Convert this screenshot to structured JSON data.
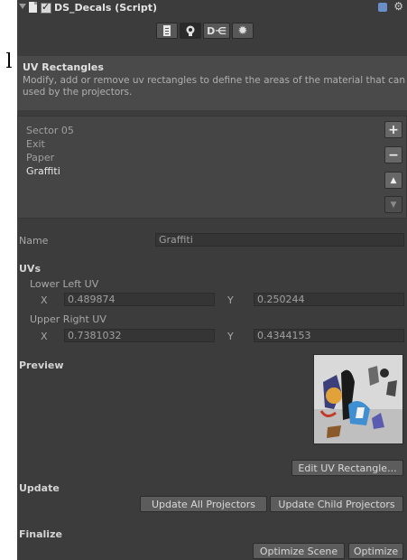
{
  "background_letter": "l",
  "component": {
    "title": "DS_Decals (Script)"
  },
  "info": {
    "heading": "UV Rectangles",
    "description": "Modify, add or remove uv rectangles to define the areas of the material that can used by the projectors."
  },
  "list": {
    "items": [
      "Sector 05",
      "Exit",
      "Paper",
      "Graffiti"
    ],
    "selected": "Graffiti",
    "buttons": {
      "add": "+",
      "remove": "−",
      "up": "▲",
      "down": "▼"
    }
  },
  "name": {
    "label": "Name",
    "value": "Graffiti"
  },
  "uvs": {
    "heading": "UVs",
    "lower_left": {
      "label": "Lower Left UV",
      "x_label": "X",
      "x": "0.489874",
      "y_label": "Y",
      "y": "0.250244"
    },
    "upper_right": {
      "label": "Upper Right UV",
      "x_label": "X",
      "x": "0.7381032",
      "y_label": "Y",
      "y": "0.4344153"
    }
  },
  "preview": {
    "heading": "Preview",
    "edit_button": "Edit UV Rectangle..."
  },
  "update": {
    "heading": "Update",
    "all_button": "Update All Projectors",
    "child_button": "Update Child Projectors"
  },
  "finalize": {
    "heading": "Finalize",
    "optimize_scene_button": "Optimize Scene",
    "optimize_button": "Optimize"
  },
  "colors": {
    "panel": "#3c3c3c",
    "info_bg": "#4a4a4a",
    "field_bg": "#353535",
    "selected_text": "#e8e8e8"
  }
}
